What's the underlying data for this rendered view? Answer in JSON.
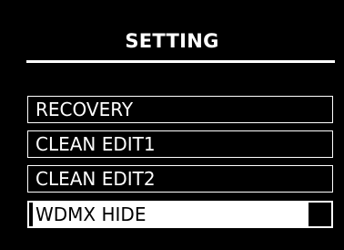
{
  "screen": {
    "title": "SETTING",
    "menu_items": [
      {
        "label": "RECOVERY",
        "selected": false
      },
      {
        "label": "CLEAN EDIT1",
        "selected": false
      },
      {
        "label": "CLEAN EDIT2",
        "selected": false
      },
      {
        "label": "WDMX HIDE",
        "selected": true
      }
    ]
  },
  "colors": {
    "background": "#000000",
    "foreground": "#ffffff",
    "selection_fill": "#ffffff",
    "selection_text": "#000000"
  }
}
